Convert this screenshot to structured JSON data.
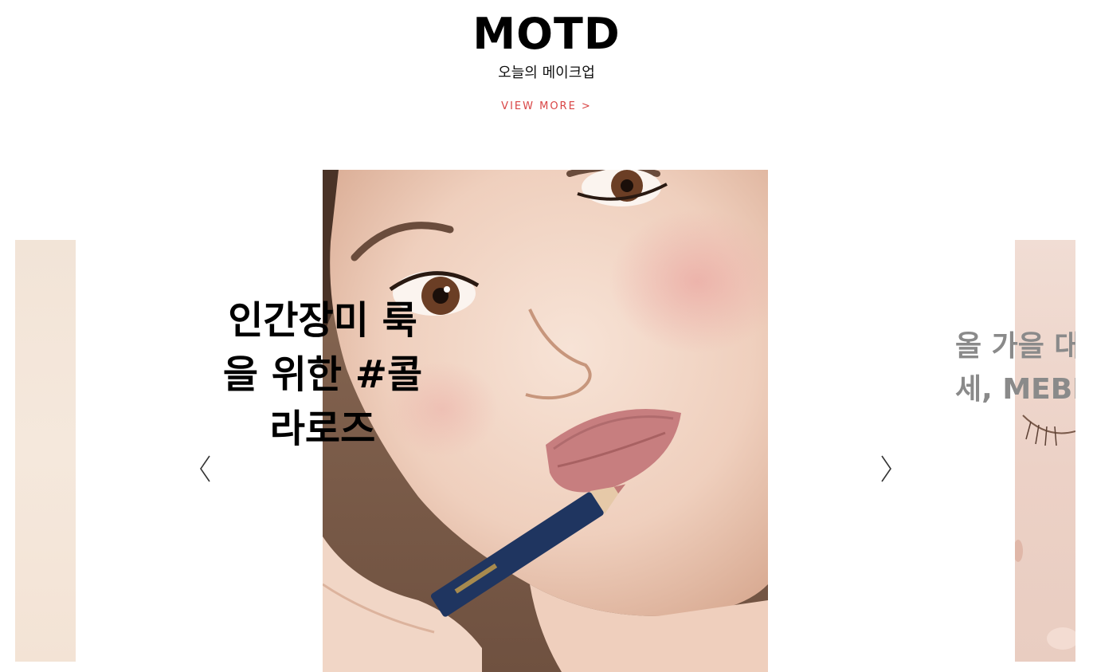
{
  "header": {
    "title": "MOTD",
    "subtitle": "오늘의 메이크업",
    "view_more": "VIEW MORE >"
  },
  "slider": {
    "main_caption_lines": [
      "인간장미 룩",
      "을 위한 #콜",
      "라로즈"
    ],
    "side_caption_lines": [
      "올 가을 대",
      "세, MEBB"
    ],
    "prev_icon": "chevron-left-icon",
    "next_icon": "chevron-right-icon"
  },
  "colors": {
    "accent": "#d94545",
    "caption_dark": "#000000",
    "caption_muted": "#8a8a8a"
  }
}
